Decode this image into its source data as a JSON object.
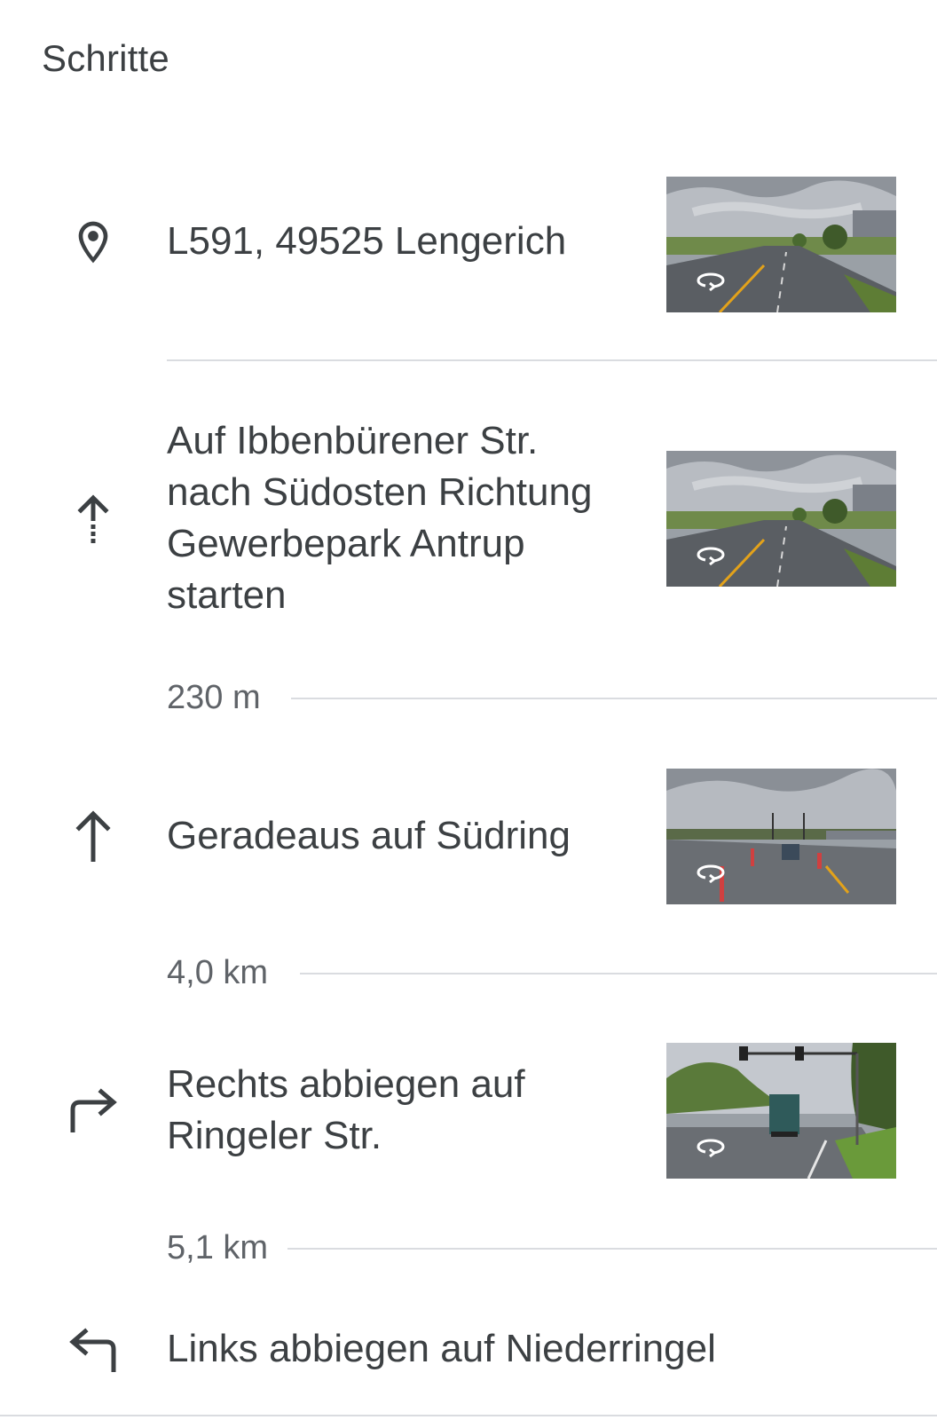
{
  "header": {
    "title": "Schritte"
  },
  "steps": [
    {
      "icon": "place-pin-icon",
      "text": "L591, 49525 Lengerich",
      "thumbnail": "street-view-thumbnail"
    },
    {
      "icon": "dotted-arrow-up-icon",
      "text": "Auf Ibbenbürener Str. nach Südosten Richtung Gewerbepark Antrup starten",
      "thumbnail": "street-view-thumbnail",
      "distance": "230 m"
    },
    {
      "icon": "arrow-up-icon",
      "text": "Geradeaus auf Südring",
      "thumbnail": "street-view-thumbnail",
      "distance": "4,0 km"
    },
    {
      "icon": "turn-right-icon",
      "text": "Rechts abbiegen auf Ringeler Str.",
      "thumbnail": "street-view-thumbnail",
      "distance": "5,1 km"
    },
    {
      "icon": "turn-left-icon",
      "text": "Links abbiegen auf Niederringel"
    }
  ],
  "colors": {
    "text_primary": "#3c4043",
    "text_secondary": "#5f6368",
    "divider": "#dadce0",
    "icon": "#3c4043"
  }
}
